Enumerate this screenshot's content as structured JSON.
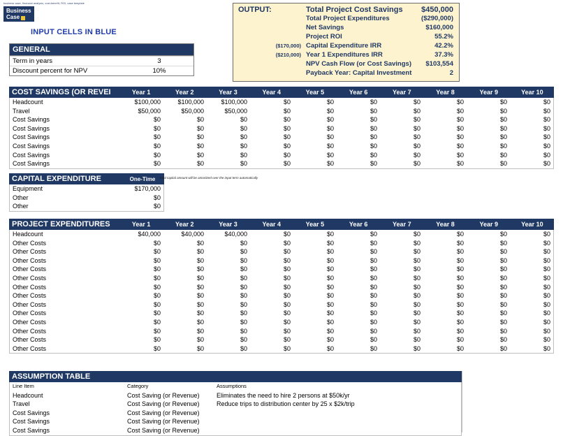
{
  "logo": {
    "tagline": "business case, financial analysis, cost-benefit, ROI, case template",
    "line1": "Business",
    "line2": "Case"
  },
  "input_note": "INPUT CELLS IN BLUE",
  "output": {
    "title": "OUTPUT:",
    "rows": [
      {
        "label": "Total Project Cost Savings",
        "sub": "",
        "value": "$450,000"
      },
      {
        "label": "Total Project Expenditures",
        "sub": "",
        "value": "($290,000)"
      },
      {
        "label": "Net Savings",
        "sub": "",
        "value": "$160,000"
      },
      {
        "label": "Project ROI",
        "sub": "",
        "value": "55.2%"
      },
      {
        "label": "Capital Expenditure IRR",
        "sub": "($170,000)",
        "value": "42.2%"
      },
      {
        "label": "Year 1 Expenditures IRR",
        "sub": "($210,000)",
        "value": "37.3%"
      },
      {
        "label": "NPV Cash Flow (or Cost Savings)",
        "sub": "",
        "value": "$103,554"
      },
      {
        "label": "Payback Year: Capital Investment",
        "sub": "",
        "value": "2"
      }
    ]
  },
  "general": {
    "title": "GENERAL",
    "rows": [
      {
        "label": "Term in years",
        "value": "3"
      },
      {
        "label": "Discount percent for NPV",
        "value": "10%"
      }
    ]
  },
  "years": [
    "Year 1",
    "Year 2",
    "Year 3",
    "Year 4",
    "Year 5",
    "Year 6",
    "Year 7",
    "Year 8",
    "Year 9",
    "Year 10"
  ],
  "cost_savings": {
    "title": "COST SAVINGS (OR REVEI",
    "rows": [
      {
        "label": "Headcount",
        "values": [
          "$100,000",
          "$100,000",
          "$100,000",
          "$0",
          "$0",
          "$0",
          "$0",
          "$0",
          "$0",
          "$0"
        ]
      },
      {
        "label": "Travel",
        "values": [
          "$50,000",
          "$50,000",
          "$50,000",
          "$0",
          "$0",
          "$0",
          "$0",
          "$0",
          "$0",
          "$0"
        ]
      },
      {
        "label": "Cost Savings",
        "values": [
          "$0",
          "$0",
          "$0",
          "$0",
          "$0",
          "$0",
          "$0",
          "$0",
          "$0",
          "$0"
        ]
      },
      {
        "label": "Cost Savings",
        "values": [
          "$0",
          "$0",
          "$0",
          "$0",
          "$0",
          "$0",
          "$0",
          "$0",
          "$0",
          "$0"
        ]
      },
      {
        "label": "Cost Savings",
        "values": [
          "$0",
          "$0",
          "$0",
          "$0",
          "$0",
          "$0",
          "$0",
          "$0",
          "$0",
          "$0"
        ]
      },
      {
        "label": "Cost Savings",
        "values": [
          "$0",
          "$0",
          "$0",
          "$0",
          "$0",
          "$0",
          "$0",
          "$0",
          "$0",
          "$0"
        ]
      },
      {
        "label": "Cost Savings",
        "values": [
          "$0",
          "$0",
          "$0",
          "$0",
          "$0",
          "$0",
          "$0",
          "$0",
          "$0",
          "$0"
        ]
      },
      {
        "label": "Cost Savings",
        "values": [
          "$0",
          "$0",
          "$0",
          "$0",
          "$0",
          "$0",
          "$0",
          "$0",
          "$0",
          "$0"
        ]
      }
    ]
  },
  "capital_expenditure": {
    "title": "CAPITAL EXPENDITURE",
    "col_header": "One-Time",
    "note": "Total capital amount will be amortized over the input term automatically",
    "rows": [
      {
        "label": "Equipment",
        "value": "$170,000"
      },
      {
        "label": "Other",
        "value": "$0"
      },
      {
        "label": "Other",
        "value": "$0"
      }
    ]
  },
  "project_expenditures": {
    "title": "PROJECT EXPENDITURES",
    "rows": [
      {
        "label": "Headcount",
        "values": [
          "$40,000",
          "$40,000",
          "$40,000",
          "$0",
          "$0",
          "$0",
          "$0",
          "$0",
          "$0",
          "$0"
        ]
      },
      {
        "label": "Other Costs",
        "values": [
          "$0",
          "$0",
          "$0",
          "$0",
          "$0",
          "$0",
          "$0",
          "$0",
          "$0",
          "$0"
        ]
      },
      {
        "label": "Other Costs",
        "values": [
          "$0",
          "$0",
          "$0",
          "$0",
          "$0",
          "$0",
          "$0",
          "$0",
          "$0",
          "$0"
        ]
      },
      {
        "label": "Other Costs",
        "values": [
          "$0",
          "$0",
          "$0",
          "$0",
          "$0",
          "$0",
          "$0",
          "$0",
          "$0",
          "$0"
        ]
      },
      {
        "label": "Other Costs",
        "values": [
          "$0",
          "$0",
          "$0",
          "$0",
          "$0",
          "$0",
          "$0",
          "$0",
          "$0",
          "$0"
        ]
      },
      {
        "label": "Other Costs",
        "values": [
          "$0",
          "$0",
          "$0",
          "$0",
          "$0",
          "$0",
          "$0",
          "$0",
          "$0",
          "$0"
        ]
      },
      {
        "label": "Other Costs",
        "values": [
          "$0",
          "$0",
          "$0",
          "$0",
          "$0",
          "$0",
          "$0",
          "$0",
          "$0",
          "$0"
        ]
      },
      {
        "label": "Other Costs",
        "values": [
          "$0",
          "$0",
          "$0",
          "$0",
          "$0",
          "$0",
          "$0",
          "$0",
          "$0",
          "$0"
        ]
      },
      {
        "label": "Other Costs",
        "values": [
          "$0",
          "$0",
          "$0",
          "$0",
          "$0",
          "$0",
          "$0",
          "$0",
          "$0",
          "$0"
        ]
      },
      {
        "label": "Other Costs",
        "values": [
          "$0",
          "$0",
          "$0",
          "$0",
          "$0",
          "$0",
          "$0",
          "$0",
          "$0",
          "$0"
        ]
      },
      {
        "label": "Other Costs",
        "values": [
          "$0",
          "$0",
          "$0",
          "$0",
          "$0",
          "$0",
          "$0",
          "$0",
          "$0",
          "$0"
        ]
      },
      {
        "label": "Other Costs",
        "values": [
          "$0",
          "$0",
          "$0",
          "$0",
          "$0",
          "$0",
          "$0",
          "$0",
          "$0",
          "$0"
        ]
      },
      {
        "label": "Other Costs",
        "values": [
          "$0",
          "$0",
          "$0",
          "$0",
          "$0",
          "$0",
          "$0",
          "$0",
          "$0",
          "$0"
        ]
      },
      {
        "label": "Other Costs",
        "values": [
          "$0",
          "$0",
          "$0",
          "$0",
          "$0",
          "$0",
          "$0",
          "$0",
          "$0",
          "$0"
        ]
      }
    ]
  },
  "assumption_table": {
    "title": "ASSUMPTION TABLE",
    "headers": [
      "Line Item",
      "Category",
      "Assumptions"
    ],
    "rows": [
      {
        "item": "Headcount",
        "category": "Cost Saving (or Revenue)",
        "assumption": "Eliminates the need to hire 2 persons at $50k/yr"
      },
      {
        "item": "Travel",
        "category": "Cost Saving (or Revenue)",
        "assumption": "Reduce trips to distribution center by 25 x $2k/trip"
      },
      {
        "item": "Cost Savings",
        "category": "Cost Saving (or Revenue)",
        "assumption": ""
      },
      {
        "item": "Cost Savings",
        "category": "Cost Saving (or Revenue)",
        "assumption": ""
      },
      {
        "item": "Cost Savings",
        "category": "Cost Saving (or Revenue)",
        "assumption": ""
      }
    ]
  },
  "colors": {
    "header_blue": "#1f3864",
    "output_bg": "#fdf3cf",
    "input_text": "#1f3ba8"
  }
}
